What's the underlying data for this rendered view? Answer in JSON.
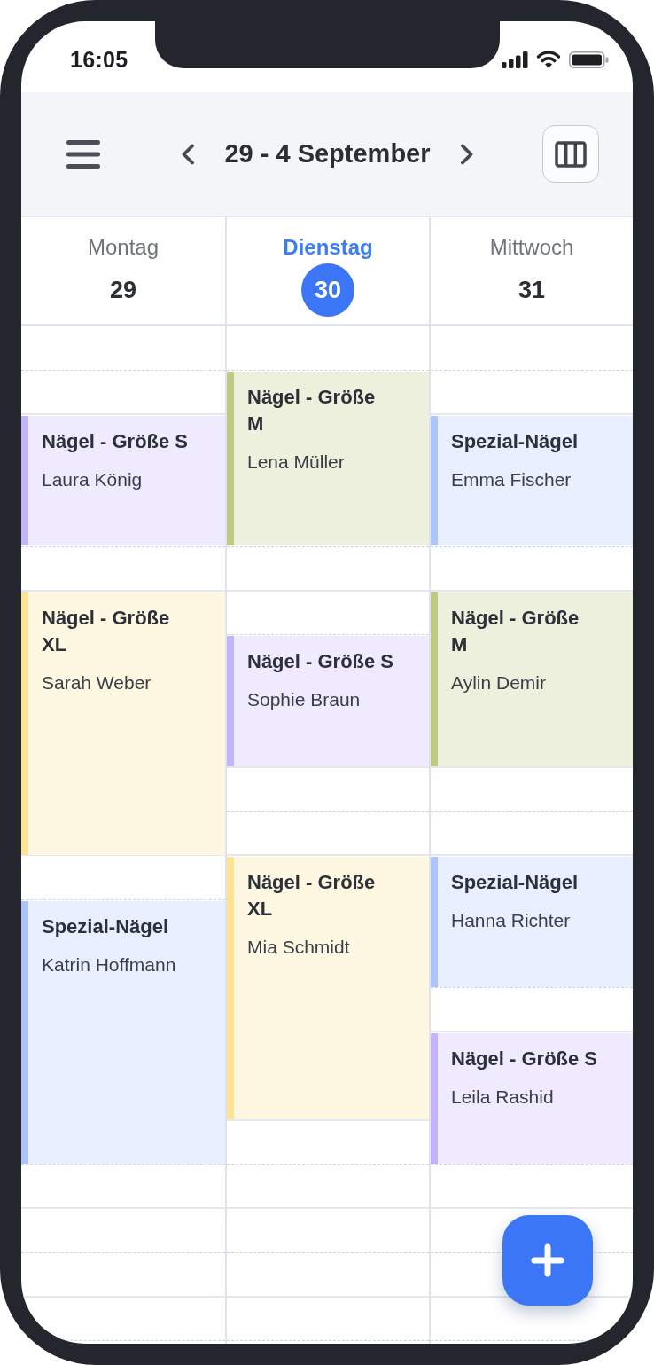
{
  "status_bar": {
    "time": "16:05"
  },
  "toolbar": {
    "title": "29 - 4 September"
  },
  "days": [
    {
      "name": "Montag",
      "date": "29",
      "selected": false,
      "events": [
        {
          "title": "Nägel - Größe S",
          "client": "Laura König",
          "color": "#c5b3fb"
        },
        {
          "title": "Nägel - Größe XL",
          "client": "Sarah Weber",
          "color": "#fde394"
        },
        {
          "title": "Spezial-Nägel",
          "client": "Katrin Hoffmann",
          "color": "#adc5fb"
        }
      ]
    },
    {
      "name": "Dienstag",
      "date": "30",
      "selected": true,
      "events": [
        {
          "title": "Nägel - Größe M",
          "client": "Lena Müller",
          "color": "#bec983"
        },
        {
          "title": "Nägel - Größe S",
          "client": "Sophie Braun",
          "color": "#c5b3fb"
        },
        {
          "title": "Nägel - Größe XL",
          "client": "Mia Schmidt",
          "color": "#fde394"
        }
      ]
    },
    {
      "name": "Mittwoch",
      "date": "31",
      "selected": false,
      "events": [
        {
          "title": "Spezial-Nägel",
          "client": "Emma Fischer",
          "color": "#adc5fb"
        },
        {
          "title": "Nägel - Größe M",
          "client": "Aylin Demir",
          "color": "#bec983"
        },
        {
          "title": "Spezial-Nägel",
          "client": "Hanna Richter",
          "color": "#adc5fb"
        },
        {
          "title": "Nägel - Größe S",
          "client": "Leila Rashid",
          "color": "#c5b3fb"
        }
      ]
    }
  ]
}
